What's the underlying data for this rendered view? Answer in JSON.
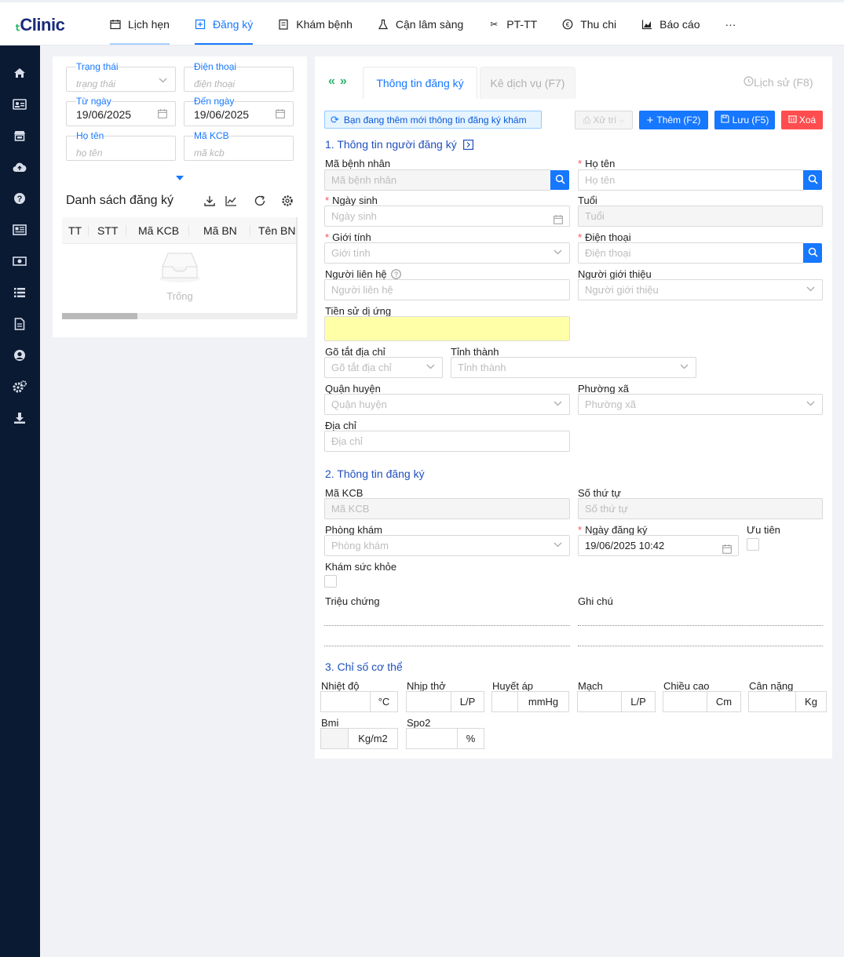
{
  "app": {
    "logo": "Clinic"
  },
  "nav": {
    "items": [
      {
        "label": "Lịch hẹn",
        "icon": "calendar-icon"
      },
      {
        "label": "Đăng ký",
        "icon": "plus-square-icon"
      },
      {
        "label": "Khám bệnh",
        "icon": "clipboard-icon"
      },
      {
        "label": "Cận lâm sàng",
        "icon": "flask-icon"
      },
      {
        "label": "PT-TT",
        "icon": "scissors-icon"
      },
      {
        "label": "Thu chi",
        "icon": "currency-icon"
      },
      {
        "label": "Báo cáo",
        "icon": "chart-icon"
      }
    ],
    "more": "···"
  },
  "filters": {
    "status": {
      "label": "Trạng thái",
      "placeholder": "trạng thái"
    },
    "phone": {
      "label": "Điện thoại",
      "placeholder": "điện thoại"
    },
    "from_date": {
      "label": "Từ ngày",
      "value": "19/06/2025"
    },
    "to_date": {
      "label": "Đến ngày",
      "value": "19/06/2025"
    },
    "name": {
      "label": "Họ tên",
      "placeholder": "họ tên"
    },
    "kcb": {
      "label": "Mã KCB",
      "placeholder": "mã kcb"
    }
  },
  "list": {
    "title": "Danh sách đăng ký",
    "columns": [
      "TT",
      "STT",
      "Mã KCB",
      "Mã BN",
      "Tên BN"
    ],
    "empty": "Trống"
  },
  "tabs": {
    "active": "Thông tin đăng ký",
    "inactive": "Kê dịch vụ (F7)",
    "history": "Lịch sử (F8)"
  },
  "notice": "Bạn đang thêm mới thông tin đăng ký khám",
  "buttons": {
    "process": "Xử trí",
    "add": "Thêm (F2)",
    "save": "Lưu (F5)",
    "delete": "Xoá"
  },
  "sec1": {
    "title": "1. Thông tin người đăng ký",
    "patient_id": {
      "label": "Mã bệnh nhân",
      "placeholder": "Mã bệnh nhân"
    },
    "full_name": {
      "label": "Họ tên",
      "placeholder": "Họ tên"
    },
    "dob": {
      "label": "Ngày sinh",
      "placeholder": "Ngày sinh"
    },
    "age": {
      "label": "Tuổi",
      "placeholder": "Tuổi"
    },
    "gender": {
      "label": "Giới tính",
      "placeholder": "Giới tính"
    },
    "phone": {
      "label": "Điện thoại",
      "placeholder": "Điện thoại"
    },
    "contact": {
      "label": "Người liên hệ",
      "placeholder": "Người liên hệ"
    },
    "referrer": {
      "label": "Người giới thiệu",
      "placeholder": "Người giới thiệu"
    },
    "allergy": {
      "label": "Tiền sử dị ứng"
    },
    "addr_short": {
      "label": "Gõ tắt địa chỉ",
      "placeholder": "Gõ tắt địa chỉ"
    },
    "province": {
      "label": "Tỉnh thành",
      "placeholder": "Tỉnh thành"
    },
    "district": {
      "label": "Quận huyện",
      "placeholder": "Quận huyện"
    },
    "ward": {
      "label": "Phường xã",
      "placeholder": "Phường xã"
    },
    "address": {
      "label": "Địa chỉ",
      "placeholder": "Địa chỉ"
    }
  },
  "sec2": {
    "title": "2. Thông tin đăng ký",
    "kcb": {
      "label": "Mã KCB",
      "placeholder": "Mã KCB"
    },
    "order": {
      "label": "Số thứ tự",
      "placeholder": "Số thứ tự"
    },
    "room": {
      "label": "Phòng khám",
      "placeholder": "Phòng khám"
    },
    "reg_date": {
      "label": "Ngày đăng ký",
      "value": "19/06/2025 10:42"
    },
    "priority": {
      "label": "Ưu tiên"
    },
    "health_check": {
      "label": "Khám sức khỏe"
    },
    "symptoms": {
      "label": "Triệu chứng"
    },
    "notes": {
      "label": "Ghi chú"
    }
  },
  "sec3": {
    "title": "3. Chỉ số cơ thể",
    "temp": {
      "label": "Nhiệt độ",
      "unit": "°C"
    },
    "resp": {
      "label": "Nhịp thở",
      "unit": "L/P"
    },
    "bp": {
      "label": "Huyết áp",
      "unit": "mmHg"
    },
    "pulse": {
      "label": "Mạch",
      "unit": "L/P"
    },
    "height": {
      "label": "Chiều cao",
      "unit": "Cm"
    },
    "weight": {
      "label": "Cân nặng",
      "unit": "Kg"
    },
    "bmi": {
      "label": "Bmi",
      "unit": "Kg/m2"
    },
    "spo2": {
      "label": "Spo2",
      "unit": "%"
    }
  }
}
